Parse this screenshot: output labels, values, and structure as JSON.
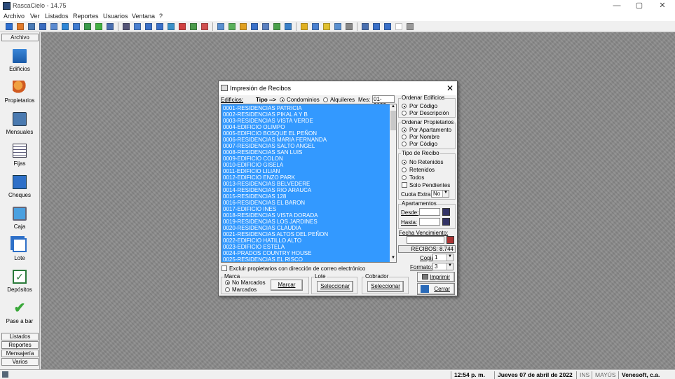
{
  "window": {
    "title": "RascaCielo - 14.75",
    "min": "—",
    "max": "▢",
    "close": "✕"
  },
  "menu": [
    "Archivo",
    "Ver",
    "Listados",
    "Reportes",
    "Usuarios",
    "Ventana",
    "?"
  ],
  "sidebar": {
    "header": "Archivo",
    "items": [
      "Edificios",
      "Propietarios",
      "Mensuales",
      "Fijas",
      "Cheques",
      "Caja",
      "Lote",
      "Depósitos",
      "Pase a bar"
    ],
    "bottom": [
      "Listados",
      "Reportes",
      "Mensajería",
      "Varios"
    ]
  },
  "dialog": {
    "title": "Impresión de Recibos",
    "close": "✕",
    "edificios_label": "Edificios:",
    "tipo_label": "Tipo -->",
    "tipo_options": [
      "Condominios",
      "Alquileres"
    ],
    "mes_label": "Mes:",
    "mes_value": "01-2022",
    "buildings": [
      "0001-RESIDENCIAS PATRICIA",
      "0002-RESIDENCIAS PIKAL A Y B",
      "0003-RESIDENCIAS VISTA VERDE",
      "0004-EDIFICIO OLIMPO",
      "0005-EDIFICIO BOSQUE EL PEÑON",
      "0006-RESIDENCIAS MARIA FERNANDA",
      "0007-RESIDENCIAS SALTO ANGEL",
      "0008-RESIDENCIAS SAN LUIS",
      "0009-EDIFICIO COLON",
      "0010-EDIFICIO GISELA",
      "0011-EDIFICIO LILIAN",
      "0012-EDIFICIO ENZO PARK",
      "0013-RESIDENCIAS BELVEDERE",
      "0014-RESIDENCIAS RIO ARAUCA",
      "0015-RESIDENCIAS 128",
      "0016-RESIDENCIAS EL BARON",
      "0017-EDIFICIO INES",
      "0018-RESIDENCIAS VISTA DORADA",
      "0019-RESIDENCIAS LOS JARDINES",
      "0020-RESIDENCIAS CLAUDIA",
      "0021-RESIDENCIAS ALTOS DEL PEÑON",
      "0022-EDIFICIO HATILLO ALTO",
      "0023-EDIFICIO ESTELA",
      "0024-PRADOS COUNTRY HOUSE",
      "0025-RESIDENCIAS EL RISCO"
    ],
    "ordenar_edificios": {
      "title": "Ordenar Edificios",
      "options": [
        "Por Código",
        "Por Descripción"
      ]
    },
    "ordenar_propietarios": {
      "title": "Ordenar Propietarios",
      "options": [
        "Por Apartamento",
        "Por Nombre",
        "Por Código"
      ]
    },
    "tipo_recibo": {
      "title": "Tipo de Recibo",
      "options": [
        "No Retenidos",
        "Retenidos",
        "Todos"
      ],
      "solo_pendientes": "Solo Pendientes",
      "cuota_label": "Cuota Extra:",
      "cuota_value": "No"
    },
    "apartamentos": {
      "title": "Apartamentos",
      "desde": "Desde:",
      "hasta": "Hasta:"
    },
    "fecha_label": "Fecha Vencimiento:",
    "recibos": "RECIBOS: 8.744",
    "copias_label": "Copias:",
    "copias_value": "1",
    "formato_label": "Formato:",
    "formato_value": "3",
    "excluir": "Excluir propietarios con dirección de correo electrónico",
    "marca": {
      "title": "Marca",
      "options": [
        "No Marcados",
        "Marcados"
      ],
      "button": "Marcar"
    },
    "lote": {
      "title": "Lote",
      "button": "Seleccionar"
    },
    "cobrador": {
      "title": "Cobrador",
      "button": "Seleccionar"
    },
    "imprimir": "Imprimir",
    "cerrar": "Cerrar"
  },
  "status": {
    "time": "12:54 p. m.",
    "date": "Jueves 07 de abril de 2022",
    "ins": "INS",
    "mayus": "MAYÚS",
    "company": "Venesoft, c.a."
  }
}
